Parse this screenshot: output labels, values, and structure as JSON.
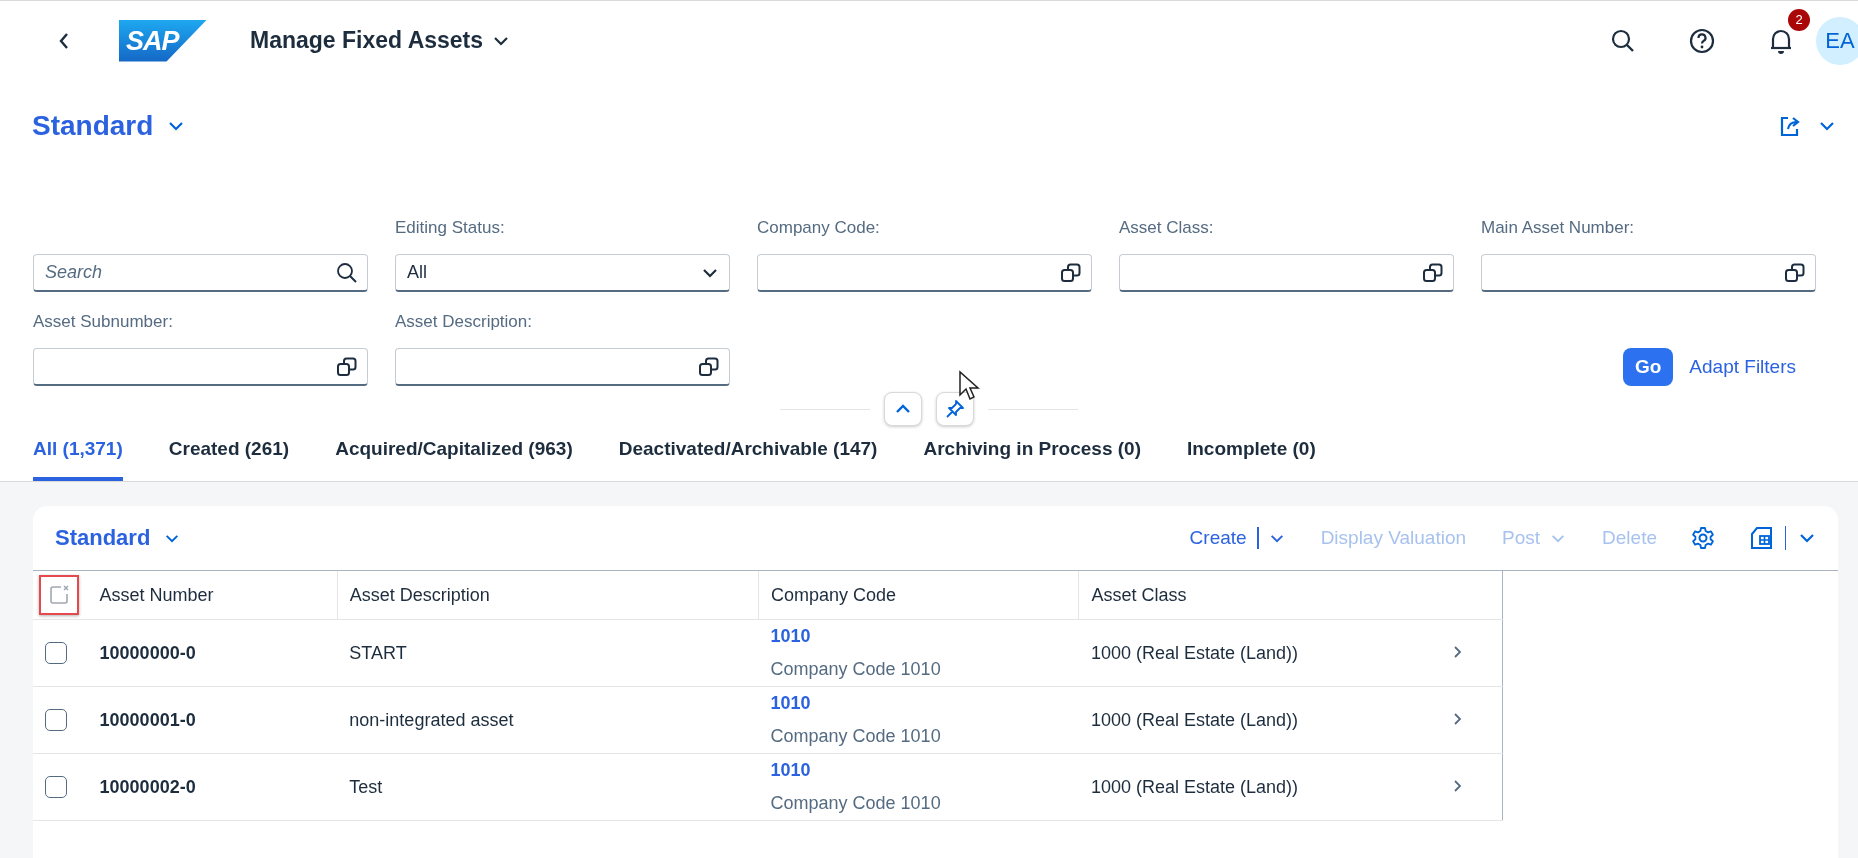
{
  "shell": {
    "logo": "SAP",
    "title": "Manage Fixed Assets",
    "notification_count": "2",
    "avatar": "EA"
  },
  "variant": {
    "title": "Standard"
  },
  "filters": {
    "search": {
      "placeholder": "Search"
    },
    "fields": [
      {
        "label": "Editing Status:",
        "kind": "select",
        "value": "All"
      },
      {
        "label": "Company Code:",
        "kind": "valuehelp"
      },
      {
        "label": "Asset Class:",
        "kind": "valuehelp"
      },
      {
        "label": "Main Asset Number:",
        "kind": "valuehelp"
      },
      {
        "label": "Asset Subnumber:",
        "kind": "valuehelp"
      },
      {
        "label": "Asset Description:",
        "kind": "valuehelp"
      }
    ],
    "go": "Go",
    "adapt": "Adapt Filters"
  },
  "tabs": [
    {
      "label": "All (1,371)",
      "selected": true
    },
    {
      "label": "Created (261)",
      "selected": false
    },
    {
      "label": "Acquired/Capitalized (963)",
      "selected": false
    },
    {
      "label": "Deactivated/Archivable (147)",
      "selected": false
    },
    {
      "label": "Archiving in Process (0)",
      "selected": false
    },
    {
      "label": "Incomplete (0)",
      "selected": false
    }
  ],
  "table": {
    "variant": "Standard",
    "toolbar": [
      {
        "label": "Create",
        "kind": "split",
        "disabled": false
      },
      {
        "label": "Display Valuation",
        "kind": "button",
        "disabled": true
      },
      {
        "label": "Post",
        "kind": "menu",
        "disabled": true
      },
      {
        "label": "Delete",
        "kind": "button",
        "disabled": true
      }
    ],
    "select_all": {
      "highlighted": true
    },
    "columns": [
      "Asset Number",
      "Asset Description",
      "Company Code",
      "Asset Class"
    ],
    "rows": [
      {
        "asset_number": "10000000-0",
        "description": "START",
        "company_code": "1010",
        "company_name": "Company Code 1010",
        "asset_class": "1000 (Real Estate (Land))",
        "selected": false
      },
      {
        "asset_number": "10000001-0",
        "description": "non-integrated asset",
        "company_code": "1010",
        "company_name": "Company Code 1010",
        "asset_class": "1000 (Real Estate (Land))",
        "selected": false
      },
      {
        "asset_number": "10000002-0",
        "description": "Test",
        "company_code": "1010",
        "company_name": "Company Code 1010",
        "asset_class": "1000 (Real Estate (Land))",
        "selected": false
      }
    ]
  }
}
